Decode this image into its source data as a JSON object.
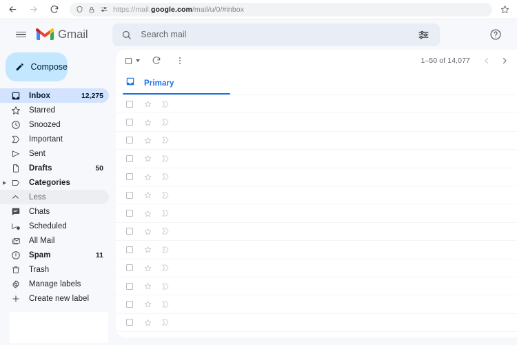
{
  "browser": {
    "back_icon": "arrow-left-icon",
    "forward_icon": "arrow-right-icon",
    "reload_icon": "reload-icon",
    "shield_icon": "shield-icon",
    "lock_icon": "lock-icon",
    "tracker_icon": "tracker-protection-icon",
    "url_scheme": "https://mail.",
    "url_domain": "google.com",
    "url_path": "/mail/u/0/#inbox",
    "bookmark_icon": "star-outline-icon"
  },
  "header": {
    "menu_icon": "hamburger-menu-icon",
    "logo_icon": "gmail-logo-icon",
    "brand": "Gmail",
    "search": {
      "icon": "search-icon",
      "placeholder": "Search mail",
      "value": "",
      "filter_icon": "tune-filter-icon"
    },
    "help_icon": "help-circle-icon"
  },
  "sidebar": {
    "compose": {
      "label": "Compose",
      "icon": "pencil-icon"
    },
    "items": [
      {
        "label": "Inbox",
        "icon": "inbox-icon",
        "count": "12,275",
        "selected": true,
        "bold": false,
        "muted": false,
        "expandable": false
      },
      {
        "label": "Starred",
        "icon": "star-icon",
        "count": "",
        "selected": false,
        "bold": false,
        "muted": false,
        "expandable": false
      },
      {
        "label": "Snoozed",
        "icon": "clock-icon",
        "count": "",
        "selected": false,
        "bold": false,
        "muted": false,
        "expandable": false
      },
      {
        "label": "Important",
        "icon": "important-icon",
        "count": "",
        "selected": false,
        "bold": false,
        "muted": false,
        "expandable": false
      },
      {
        "label": "Sent",
        "icon": "send-icon",
        "count": "",
        "selected": false,
        "bold": false,
        "muted": false,
        "expandable": false
      },
      {
        "label": "Drafts",
        "icon": "draft-icon",
        "count": "50",
        "selected": false,
        "bold": true,
        "muted": false,
        "expandable": false
      },
      {
        "label": "Categories",
        "icon": "label-icon",
        "count": "",
        "selected": false,
        "bold": true,
        "muted": false,
        "expandable": true
      },
      {
        "label": "Less",
        "icon": "chevron-up-icon",
        "count": "",
        "selected": false,
        "bold": false,
        "muted": true,
        "expandable": false
      },
      {
        "label": "Chats",
        "icon": "chat-icon",
        "count": "",
        "selected": false,
        "bold": false,
        "muted": false,
        "expandable": false
      },
      {
        "label": "Scheduled",
        "icon": "scheduled-icon",
        "count": "",
        "selected": false,
        "bold": false,
        "muted": false,
        "expandable": false
      },
      {
        "label": "All Mail",
        "icon": "all-mail-icon",
        "count": "",
        "selected": false,
        "bold": false,
        "muted": false,
        "expandable": false
      },
      {
        "label": "Spam",
        "icon": "spam-icon",
        "count": "11",
        "selected": false,
        "bold": true,
        "muted": false,
        "expandable": false
      },
      {
        "label": "Trash",
        "icon": "trash-icon",
        "count": "",
        "selected": false,
        "bold": false,
        "muted": false,
        "expandable": false
      },
      {
        "label": "Manage labels",
        "icon": "gear-icon",
        "count": "",
        "selected": false,
        "bold": false,
        "muted": false,
        "expandable": false
      },
      {
        "label": "Create new label",
        "icon": "plus-icon",
        "count": "",
        "selected": false,
        "bold": false,
        "muted": false,
        "expandable": false
      }
    ]
  },
  "toolbar": {
    "select_all_icon": "checkbox-icon",
    "select_all_caret_icon": "chevron-down-icon",
    "refresh_icon": "refresh-icon",
    "more_icon": "more-vert-icon",
    "page_range": "1–50 of 14,077",
    "prev_icon": "chevron-left-icon",
    "next_icon": "chevron-right-icon"
  },
  "tabs": [
    {
      "label": "Primary",
      "icon": "inbox-tab-icon",
      "active": true
    }
  ],
  "mail_list": {
    "row_count": 13,
    "row_icons": {
      "checkbox": "checkbox-icon",
      "star": "star-outline-icon",
      "important": "important-marker-icon"
    }
  },
  "colors": {
    "accent_blue": "#1a73e8",
    "compose_bg": "#c2e7ff",
    "selected_bg": "#d3e3fd",
    "app_bg": "#f6f8fc",
    "search_bg": "#e9eef6"
  }
}
